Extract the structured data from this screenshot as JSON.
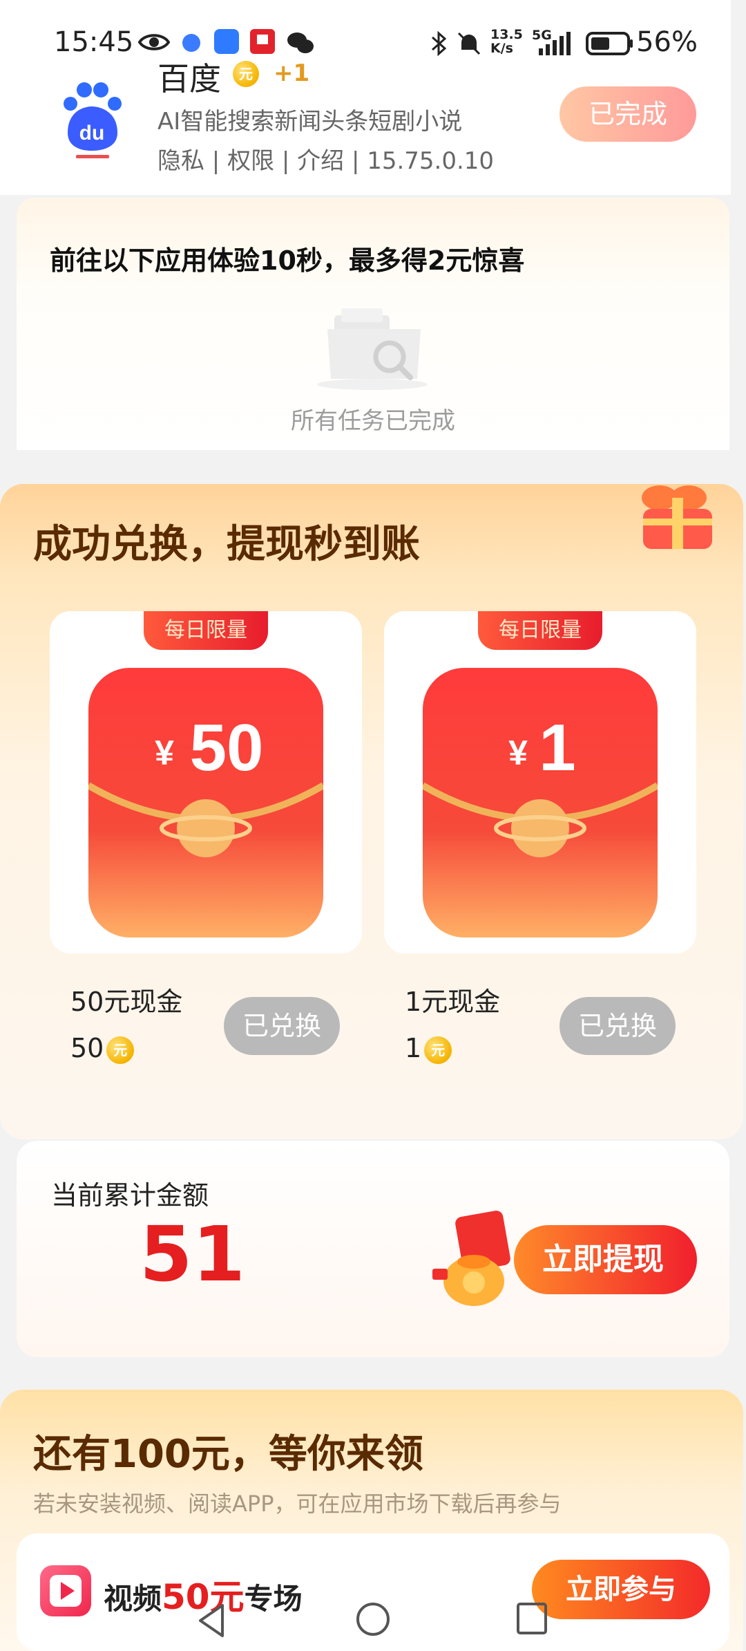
{
  "status_bar": {
    "time": "15:45",
    "net_speed_top": "13.5",
    "net_speed_bottom": "K/s",
    "network": "5G",
    "battery": "56%"
  },
  "app_item": {
    "name": "百度",
    "coin_symbol": "元",
    "bonus": "+1",
    "description": "AI智能搜索新闻头条短剧小说",
    "meta": "隐私 | 权限 | 介绍 | 15.75.0.10",
    "action_label": "已完成"
  },
  "experience": {
    "title": "前往以下应用体验10秒，最多得2元惊喜",
    "empty_text": "所有任务已完成"
  },
  "exchange": {
    "title": "成功兑换，提现秒到账",
    "prizes": [
      {
        "tag": "每日限量",
        "amount": "50",
        "currency": "¥",
        "name": "50元现金",
        "cost": "50",
        "action": "已兑换"
      },
      {
        "tag": "每日限量",
        "amount": "1",
        "currency": "¥",
        "name": "1元现金",
        "cost": "1",
        "action": "已兑换"
      }
    ]
  },
  "total": {
    "label": "当前累计金额",
    "value": "51",
    "withdraw_label": "立即提现"
  },
  "more": {
    "title": "还有100元，等你来领",
    "subtitle": "若未安装视频、阅读APP，可在应用市场下载后再参与",
    "video": {
      "prefix": "视频",
      "highlight": "50元",
      "suffix": "专场",
      "action": "立即参与"
    }
  },
  "colors": {
    "accent_red": "#e51f1f",
    "title_brown": "#5a2a00",
    "disabled_gray": "#b9b9b9"
  }
}
